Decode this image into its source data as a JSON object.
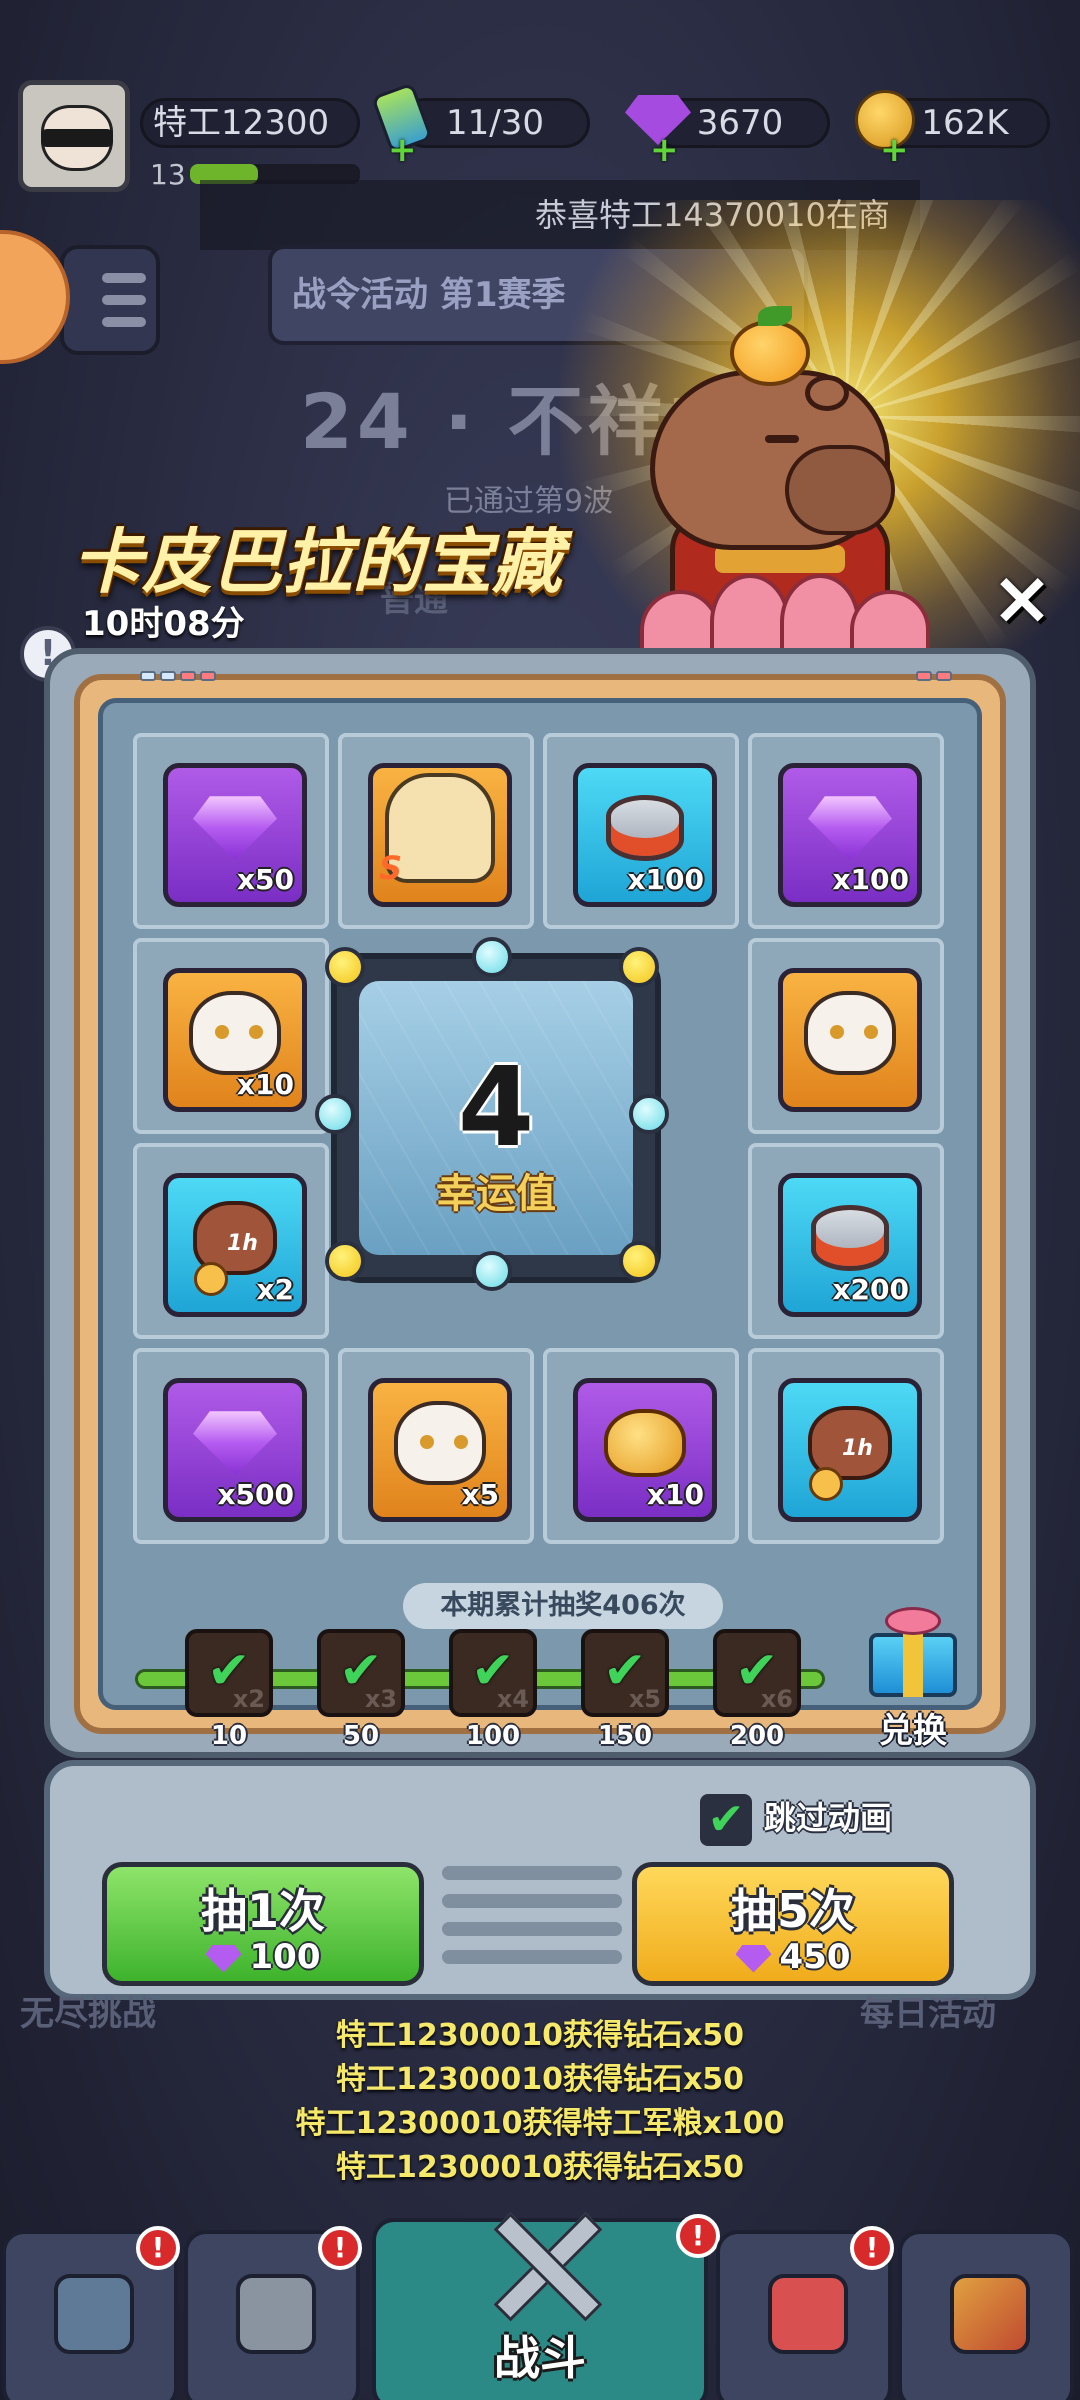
{
  "top": {
    "player_name": "特工12300",
    "level": "13",
    "energy": "11/30",
    "gems": "3670",
    "coins": "162K",
    "ticker": "恭喜特工14370010在商"
  },
  "background": {
    "season_banner": "战令活动 第1赛季",
    "stage_title": "24 · 不祥之",
    "stage_sub": "已通过第9波",
    "mode_label": "普通",
    "left_button": "无尽挑战",
    "right_button": "每日活动"
  },
  "event": {
    "title": "卡皮巴拉的宝藏",
    "timer": "10时08分",
    "close_icon": "close-icon",
    "info_icon": "info-icon"
  },
  "rewards": [
    {
      "type": "gem",
      "color": "purple",
      "qty": "x50"
    },
    {
      "type": "hero",
      "color": "orange",
      "qty": ""
    },
    {
      "type": "can",
      "color": "blue",
      "qty": "x100"
    },
    {
      "type": "gem",
      "color": "purple",
      "qty": "x100"
    },
    {
      "type": "tiger",
      "color": "orange",
      "qty": "x10"
    },
    {
      "type": "tiger",
      "color": "orange",
      "qty": ""
    },
    {
      "type": "bag",
      "color": "blue",
      "qty": "x2"
    },
    {
      "type": "can",
      "color": "blue",
      "qty": "x200"
    },
    {
      "type": "gem",
      "color": "purple",
      "qty": "x500"
    },
    {
      "type": "tiger",
      "color": "orange",
      "qty": "x5"
    },
    {
      "type": "pouch",
      "color": "purple",
      "qty": "x10"
    },
    {
      "type": "bag",
      "color": "blue",
      "qty": ""
    }
  ],
  "center": {
    "luck_value": "4",
    "luck_label": "幸运值"
  },
  "progress": {
    "draw_count": "本期累计抽奖406次",
    "milestones": [
      {
        "threshold": "10",
        "mult": "x2"
      },
      {
        "threshold": "50",
        "mult": "x3"
      },
      {
        "threshold": "100",
        "mult": "x4"
      },
      {
        "threshold": "150",
        "mult": "x5"
      },
      {
        "threshold": "200",
        "mult": "x6"
      }
    ],
    "exchange_label": "兑换"
  },
  "controls": {
    "skip_label": "跳过动画",
    "draw1_label": "抽1次",
    "draw1_cost": "100",
    "draw5_label": "抽5次",
    "draw5_cost": "450"
  },
  "feed": [
    "特工12300010获得钻石x50",
    "特工12300010获得钻石x50",
    "特工12300010获得特工军粮x100",
    "特工12300010获得钻石x50"
  ],
  "nav": {
    "battle_label": "战斗",
    "badge": "!"
  }
}
